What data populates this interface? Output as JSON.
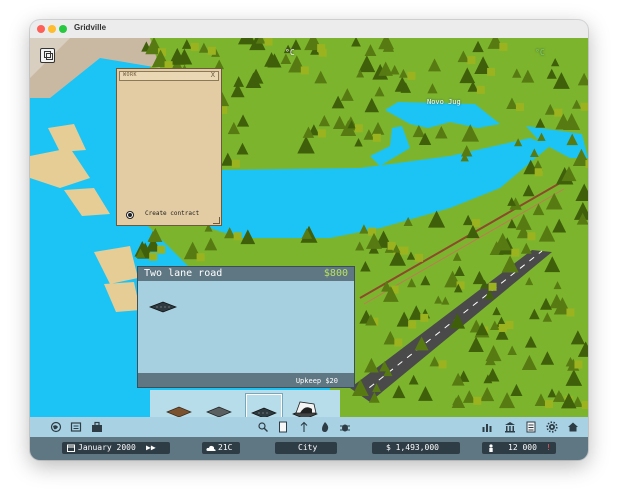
{
  "window": {
    "title": "Gridville"
  },
  "map": {
    "lake_label": "Novo Jug",
    "top_labels": [
      "°C",
      "°C"
    ]
  },
  "work_panel": {
    "title": "WORK",
    "close": "X",
    "action_label": "Create contract"
  },
  "build_panel": {
    "name": "Two lane road",
    "price": "$800",
    "upkeep": "Upkeep $20",
    "variants": [
      "dirt-road-tile",
      "one-lane-road-tile",
      "two-lane-road-tile",
      "tunnel-tile"
    ],
    "selected_variant": 2
  },
  "toolbar": {
    "left_icons": [
      "globe-icon",
      "newspaper-icon",
      "toolbox-icon"
    ],
    "center_icons": [
      "search-icon",
      "book-icon",
      "arrow-up-icon",
      "fire-icon",
      "bug-icon"
    ],
    "right_icons": [
      "bar-chart-icon",
      "bank-icon",
      "data-panel-icon",
      "gear-icon",
      "home-icon"
    ]
  },
  "status": {
    "date": "January 2000",
    "speed": "▶▶",
    "temperature": "21C",
    "view_mode": "City",
    "money": "$ 1,493,000",
    "population": "12 000",
    "alert": "!"
  },
  "colors": {
    "water": "#1cc4f5",
    "grass": "#7cb52d",
    "tree": "#4a6b0b",
    "panel": "#a6cfe0",
    "header": "#5f7683",
    "price": "#b9e35c"
  }
}
